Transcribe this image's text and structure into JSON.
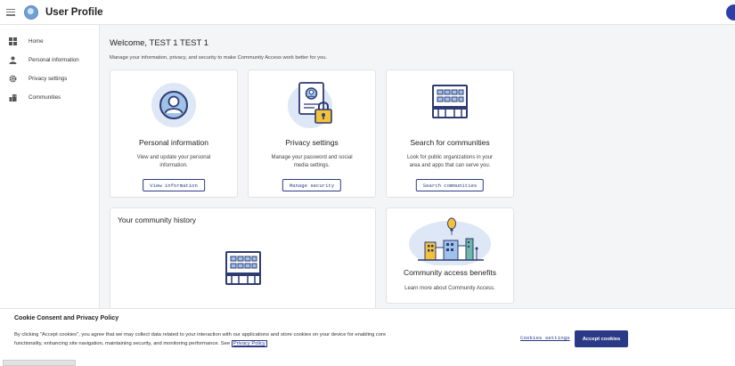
{
  "header": {
    "title": "User Profile"
  },
  "sidebar": {
    "items": [
      {
        "label": "Home",
        "icon": "grid-icon"
      },
      {
        "label": "Personal information",
        "icon": "person-icon"
      },
      {
        "label": "Privacy settings",
        "icon": "gear-icon"
      },
      {
        "label": "Communities",
        "icon": "buildings-icon"
      }
    ]
  },
  "main": {
    "welcome": "Welcome, TEST 1 TEST 1",
    "subtext": "Manage your information, privacy, and security to make Community Access work better for you.",
    "cards": [
      {
        "title": "Personal information",
        "description": "View and update your personal information.",
        "button": "View information",
        "icon": "user-circle-icon"
      },
      {
        "title": "Privacy settings",
        "description": "Manage your password and social media settings.",
        "button": "Manage security",
        "icon": "id-card-lock-icon"
      },
      {
        "title": "Search for communities",
        "description": "Look for public organizations in your area and apps that can serve you.",
        "button": "Search communities",
        "icon": "building-icon"
      }
    ],
    "history": {
      "title": "Your community history",
      "icon": "building-icon"
    },
    "benefits": {
      "title": "Community access benefits",
      "description": "Learn more about Community Access.",
      "icon": "city-balloon-icon"
    }
  },
  "cookie": {
    "title": "Cookie Consent and Privacy Policy",
    "text": "By clicking \"Accept cookies\", you agree that we may collect data related to your interaction with our applications and store cookies on your device for enabling core functionality, enhancing site navigation, maintaining security, and monitoring performance. See ",
    "link": "Privacy Policy",
    "settings": "Cookies settings",
    "accept": "Accept cookies"
  },
  "colors": {
    "primary": "#2b3a86",
    "illustration_bg": "#dde7f6",
    "illustration_stroke": "#2f3b73",
    "accent_yellow": "#f3c23a"
  }
}
